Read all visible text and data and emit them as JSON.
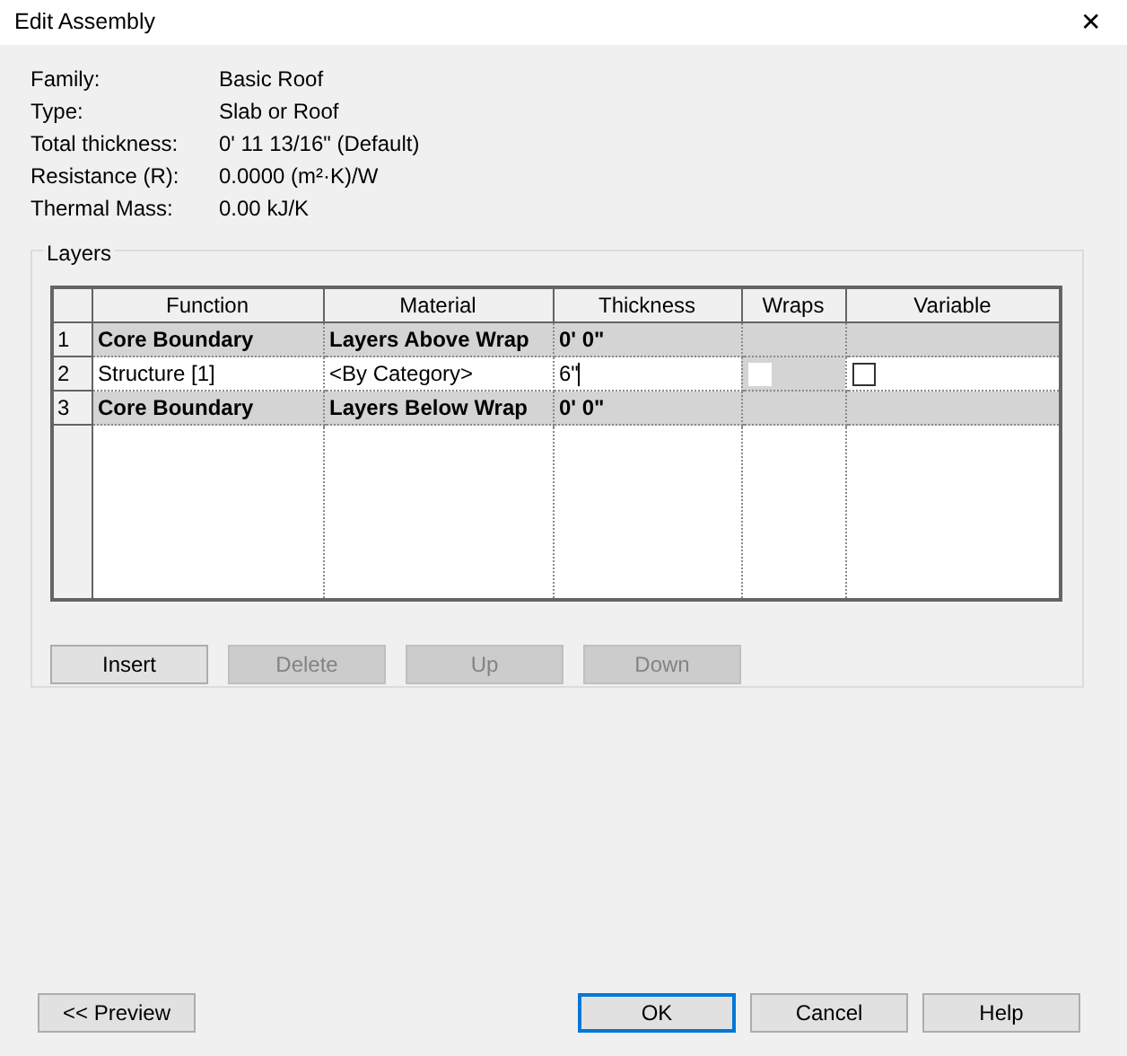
{
  "window": {
    "title": "Edit Assembly",
    "close": "✕"
  },
  "properties": [
    {
      "label": "Family:",
      "value": "Basic Roof"
    },
    {
      "label": "Type:",
      "value": "Slab or Roof"
    },
    {
      "label": "Total thickness:",
      "value": "0'  11 13/16\" (Default)"
    },
    {
      "label": "Resistance (R):",
      "value": "0.0000 (m²·K)/W"
    },
    {
      "label": "Thermal Mass:",
      "value": "0.00 kJ/K"
    }
  ],
  "layers": {
    "title": "Layers",
    "columns": [
      "Function",
      "Material",
      "Thickness",
      "Wraps",
      "Variable"
    ],
    "rows": [
      {
        "number": "1",
        "kind": "boundary",
        "function": "Core Boundary",
        "material": "Layers Above Wrap",
        "thickness": "0'  0\"",
        "editing": false
      },
      {
        "number": "2",
        "kind": "layer",
        "function": "Structure [1]",
        "material": "<By Category>",
        "thickness": "6\"",
        "editing": true,
        "wraps": {
          "checked": false,
          "disabled": true
        },
        "variable": {
          "checked": false,
          "disabled": false
        }
      },
      {
        "number": "3",
        "kind": "boundary",
        "function": "Core Boundary",
        "material": "Layers Below Wrap",
        "thickness": "0'  0\"",
        "editing": false
      }
    ],
    "buttons": [
      {
        "label": "Insert",
        "disabled": false
      },
      {
        "label": "Delete",
        "disabled": true
      },
      {
        "label": "Up",
        "disabled": true
      },
      {
        "label": "Down",
        "disabled": true
      }
    ]
  },
  "footer": {
    "left": [
      {
        "label": "<< Preview",
        "default": false
      }
    ],
    "right": [
      {
        "label": "OK",
        "default": true
      },
      {
        "label": "Cancel",
        "default": false
      },
      {
        "label": "Help",
        "default": false
      }
    ]
  }
}
